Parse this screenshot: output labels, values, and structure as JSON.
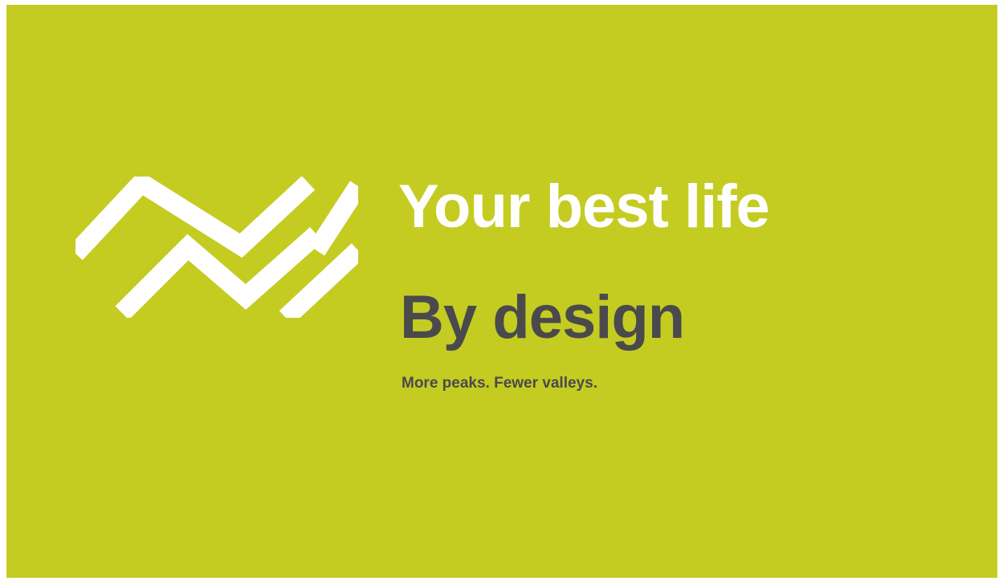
{
  "brand": {
    "logo_icon": "mountain-stripes-icon",
    "background_color": "#c4cc22",
    "headline_color": "#ffffff",
    "text_color": "#4a4a4c"
  },
  "headline": "Your best life",
  "subheadline": "By design",
  "tagline": "More peaks. Fewer valleys."
}
